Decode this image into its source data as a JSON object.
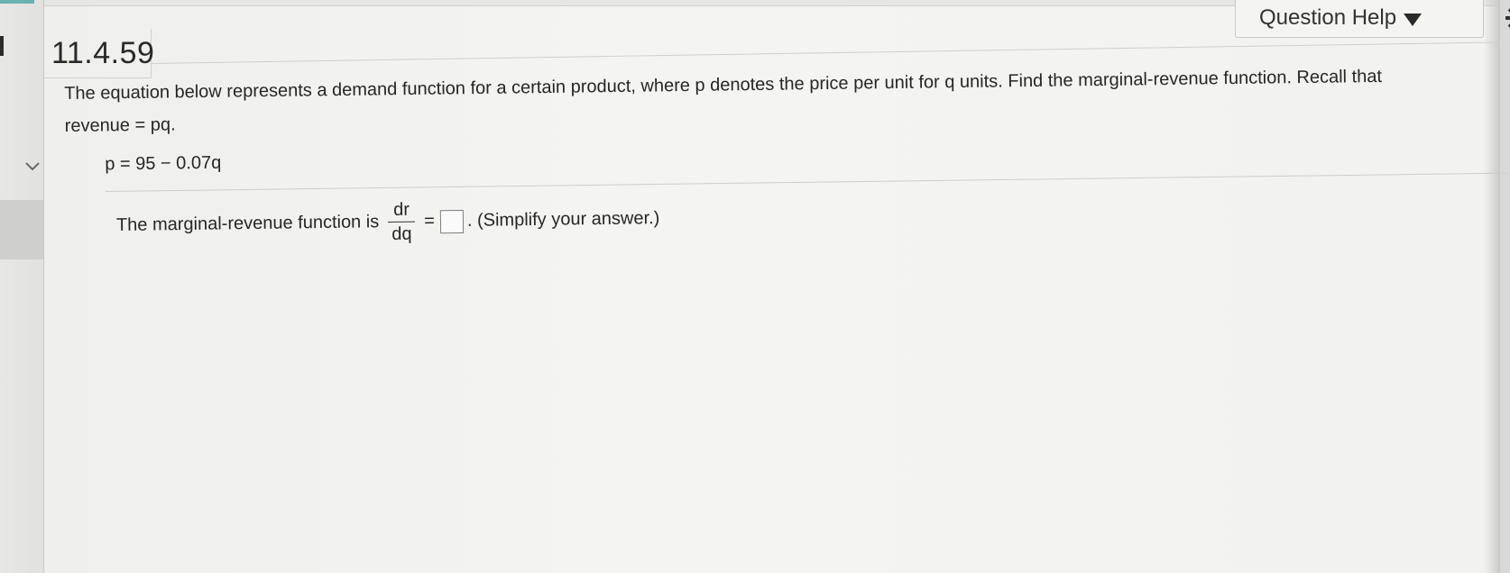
{
  "question": {
    "number": "11.4.59",
    "prompt": "The equation below represents a demand function for a certain product, where p denotes the price per unit for q units. Find the marginal-revenue function. Recall that revenue = pq.",
    "equation": "p = 95 − 0.07q"
  },
  "answer": {
    "lead_text": "The marginal-revenue function is",
    "fraction_numerator": "dr",
    "fraction_denominator": "dq",
    "equals": "=",
    "input_value": "",
    "trailing_text": ". (Simplify your answer.)"
  },
  "toolbar": {
    "help_label": "Question Help"
  },
  "icons": {
    "help_caret": "caret-down-icon",
    "settings": "gear-icon",
    "side_toggle": "chevron-left-icon"
  },
  "colors": {
    "accent_teal": "#6bb2b0"
  }
}
